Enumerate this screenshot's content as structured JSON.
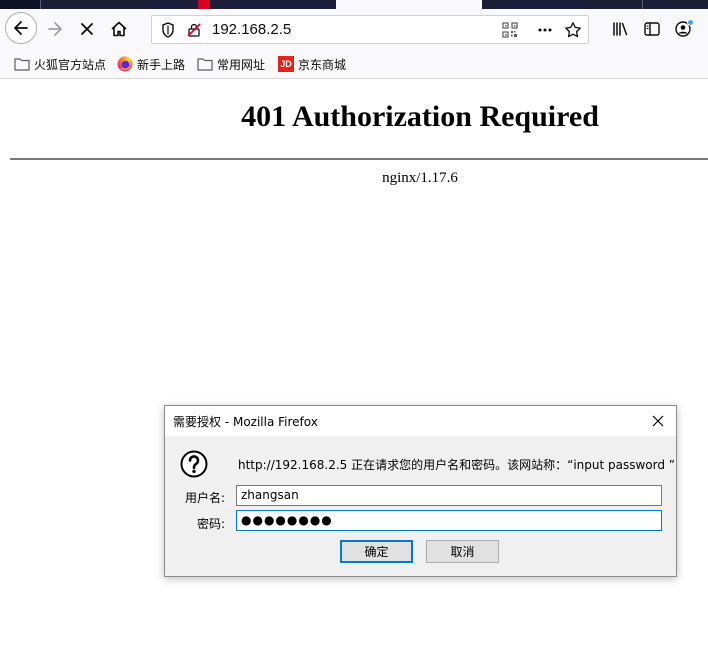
{
  "browser": {
    "url": "192.168.2.5"
  },
  "bookmarks": [
    {
      "label": "火狐官方站点",
      "icon": "folder-icon"
    },
    {
      "label": "新手上路",
      "icon": "firefox-logo-icon"
    },
    {
      "label": "常用网址",
      "icon": "folder-icon"
    },
    {
      "label": "京东商城",
      "icon": "jd-logo-icon",
      "badge": "JD"
    }
  ],
  "page": {
    "heading": "401 Authorization Required",
    "server": "nginx/1.17.6"
  },
  "dialog": {
    "title": "需要授权 - Mozilla Firefox",
    "message": "http://192.168.2.5 正在请求您的用户名和密码。该网站称：“input password ”",
    "username_label": "用户名:",
    "username_value": "zhangsan",
    "password_label": "密码:",
    "password_mask": "●●●●●●●●",
    "ok_label": "确定",
    "cancel_label": "取消"
  },
  "colors": {
    "accent": "#0078d7",
    "notification_dot": "#45a1ff",
    "jd_red": "#e1251b"
  }
}
